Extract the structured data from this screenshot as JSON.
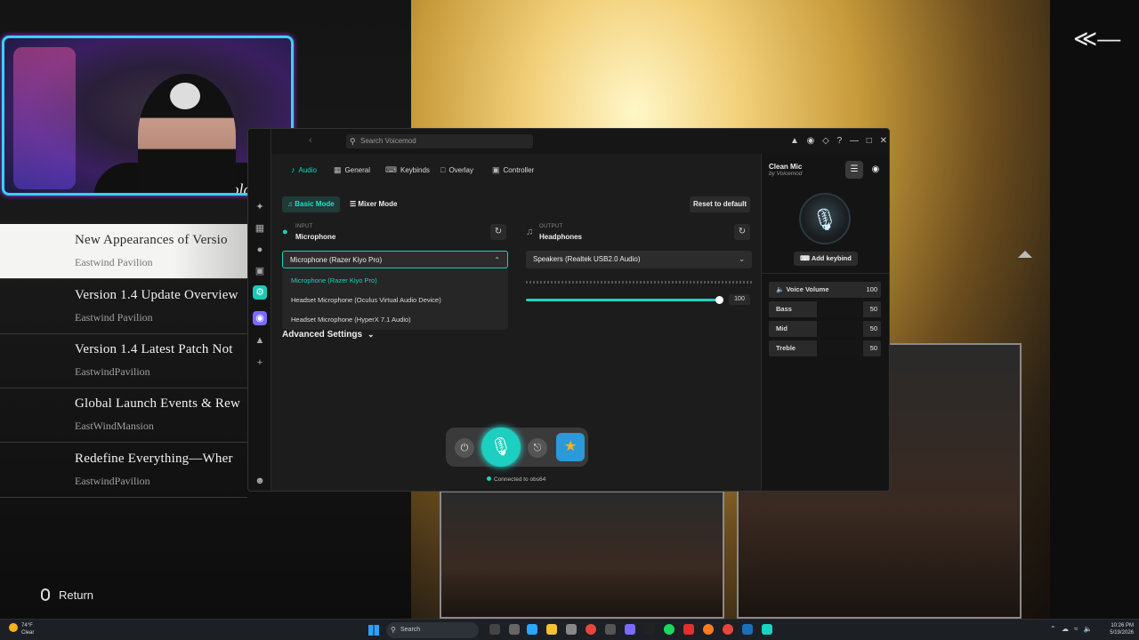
{
  "game": {
    "news": [
      {
        "title": "New Appearances of Versio",
        "source": "Eastwind Pavilion",
        "selected": true
      },
      {
        "title": "Version 1.4 Update Overview",
        "source": "Eastwind Pavilion",
        "selected": false
      },
      {
        "title": "Version 1.4 Latest Patch Not",
        "source": "EastwindPavilion",
        "selected": false
      },
      {
        "title": "Global Launch Events & Rew",
        "source": "EastWindMansion",
        "selected": false
      },
      {
        "title": "Redefine Everything—Wher",
        "source": "EastwindPavilion",
        "selected": false
      }
    ],
    "return_label": "Return",
    "back_icon": "back-arrow-icon"
  },
  "webcam": {
    "shirt_text": "Enjoy Coca-Cola"
  },
  "voicemod": {
    "search_placeholder": "Search Voicemod",
    "tabs": [
      {
        "label": "Audio",
        "icon": "audio-icon",
        "active": true
      },
      {
        "label": "General",
        "icon": "general-icon",
        "active": false
      },
      {
        "label": "Keybinds",
        "icon": "keybinds-icon",
        "active": false
      },
      {
        "label": "Overlay",
        "icon": "overlay-icon",
        "active": false
      },
      {
        "label": "Controller",
        "icon": "controller-icon",
        "active": false
      }
    ],
    "modes": {
      "basic": "Basic Mode",
      "mixer": "Mixer Mode"
    },
    "reset_label": "Reset to default",
    "input": {
      "label": "INPUT",
      "value": "Microphone",
      "device": "Microphone (Razer Kiyo Pro)"
    },
    "output": {
      "label": "OUTPUT",
      "value": "Headphones",
      "device": "Speakers (Realtek USB2.0 Audio)"
    },
    "dropdown_options": [
      "Microphone (Razer Kiyo Pro)",
      "Headset Microphone (Oculus Virtual Audio Device)",
      "Headset Microphone (HyperX 7.1 Audio)"
    ],
    "output_volume": "100",
    "advanced_settings": "Advanced Settings",
    "connection_status": "Connected to obs64",
    "voice": {
      "name": "Clean Mic",
      "by": "by Voicemod",
      "add_keybind": "Add keybind",
      "controls": [
        {
          "label": "Voice Volume",
          "value": "100"
        },
        {
          "label": "Bass",
          "value": "50"
        },
        {
          "label": "Mid",
          "value": "50"
        },
        {
          "label": "Treble",
          "value": "50"
        }
      ]
    },
    "accent_color": "#18d4bf"
  },
  "taskbar": {
    "weather_temp": "74°F",
    "weather_desc": "Clear",
    "search_label": "Search",
    "time": "10:26 PM",
    "date": "5/19/2026"
  }
}
